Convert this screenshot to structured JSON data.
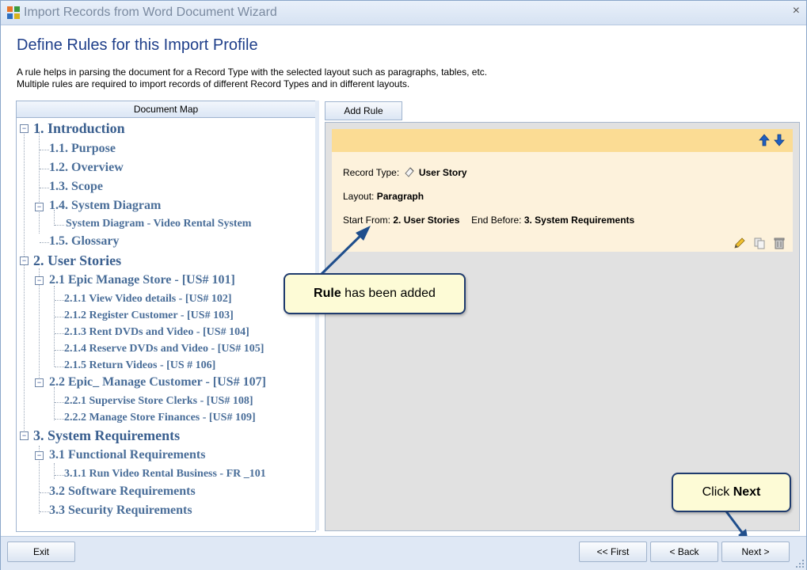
{
  "window": {
    "title": "Import Records from Word Document Wizard",
    "close_label": "×"
  },
  "page": {
    "heading": "Define Rules for this Import Profile",
    "description_line1": "A rule helps in parsing the document for a Record Type with the selected layout such as paragraphs, tables, etc.",
    "description_line2": "Multiple rules are required to import records of different Record Types and in different layouts."
  },
  "docmap": {
    "header": "Document Map",
    "items": [
      {
        "label": "1. Introduction"
      },
      {
        "label": "1.1. Purpose"
      },
      {
        "label": "1.2. Overview"
      },
      {
        "label": "1.3. Scope"
      },
      {
        "label": "1.4. System Diagram"
      },
      {
        "label": "System Diagram - Video Rental System"
      },
      {
        "label": "1.5. Glossary"
      },
      {
        "label": "2. User Stories"
      },
      {
        "label": "2.1 Epic Manage Store - [US# 101]"
      },
      {
        "label": "2.1.1 View Video details - [US# 102]"
      },
      {
        "label": "2.1.2 Register Customer - [US# 103]"
      },
      {
        "label": "2.1.3 Rent DVDs and Video - [US# 104]"
      },
      {
        "label": "2.1.4 Reserve DVDs and Video - [US# 105]"
      },
      {
        "label": "2.1.5 Return Videos - [US # 106]"
      },
      {
        "label": "2.2 Epic_ Manage Customer - [US# 107]"
      },
      {
        "label": "2.2.1 Supervise Store Clerks - [US# 108]"
      },
      {
        "label": "2.2.2 Manage Store Finances - [US# 109]"
      },
      {
        "label": "3. System Requirements"
      },
      {
        "label": "3.1 Functional Requirements"
      },
      {
        "label": "3.1.1 Run Video Rental Business - FR _101"
      },
      {
        "label": "3.2 Software Requirements"
      },
      {
        "label": "3.3 Security Requirements"
      }
    ]
  },
  "rules": {
    "add_rule_label": "Add Rule",
    "card": {
      "record_type_label": "Record Type:",
      "record_type_value": "User Story",
      "layout_label": "Layout:",
      "layout_value": "Paragraph",
      "start_from_label": "Start From:",
      "start_from_value": "2. User Stories",
      "end_before_label": "End Before:",
      "end_before_value": "3. System Requirements"
    }
  },
  "callouts": {
    "rule_bold": "Rule",
    "rule_rest": " has been added",
    "next_prefix": "Click ",
    "next_bold": "Next"
  },
  "buttons": {
    "exit": "Exit",
    "first": "<< First",
    "back": "< Back",
    "next": "Next >"
  },
  "colors": {
    "heading": "#1f3f8a",
    "tree_text": "#4a6e99",
    "card_bg": "#fdf2dc",
    "card_header": "#fbdc94",
    "callout_bg": "#fdfbd6",
    "arrow": "#1f4e8c"
  },
  "icons": {
    "app": "wizard-app-icon",
    "move_up": "arrow-up-icon",
    "move_down": "arrow-down-icon",
    "record_type": "user-story-icon",
    "edit": "pencil-icon",
    "copy": "copy-icon",
    "delete": "trash-icon"
  }
}
